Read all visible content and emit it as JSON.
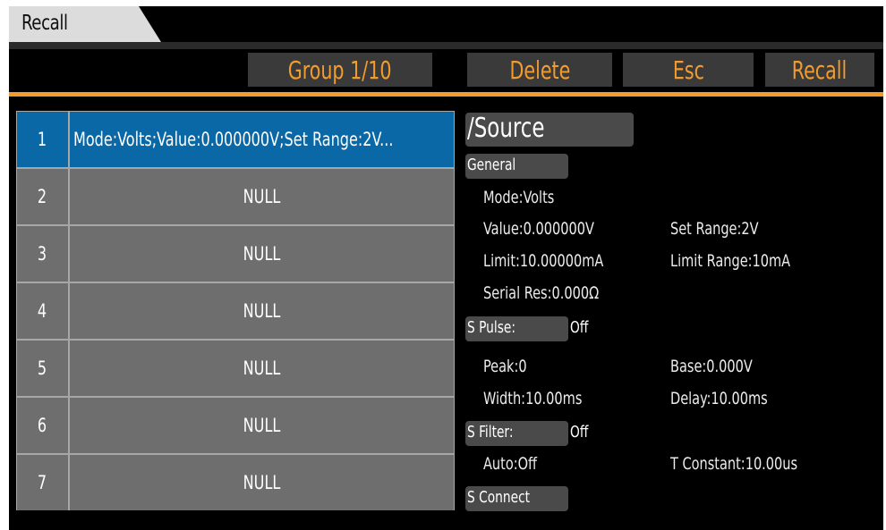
{
  "window": {
    "title": "Recall"
  },
  "toolbar": {
    "group_label": "Group 1/10",
    "delete_label": "Delete",
    "esc_label": "Esc",
    "recall_label": "Recall"
  },
  "colors": {
    "accent": "#f29c2e",
    "selected_row": "#0a68a6",
    "row_bg": "#6e6e6e"
  },
  "table": {
    "rows": [
      {
        "index": "1",
        "value": "Mode:Volts;Value:0.000000V;Set Range:2V...",
        "selected": true
      },
      {
        "index": "2",
        "value": "NULL"
      },
      {
        "index": "3",
        "value": "NULL"
      },
      {
        "index": "4",
        "value": "NULL"
      },
      {
        "index": "5",
        "value": "NULL"
      },
      {
        "index": "6",
        "value": "NULL"
      },
      {
        "index": "7",
        "value": "NULL"
      }
    ]
  },
  "details": {
    "heading": "/Source",
    "general": {
      "label": "General",
      "mode": "Mode:Volts",
      "value": "Value:0.000000V",
      "set_range": "Set Range:2V",
      "limit": "Limit:10.00000mA",
      "limit_range": "Limit Range:10mA",
      "serial_res": "Serial Res:0.000Ω"
    },
    "pulse": {
      "label": "S Pulse:",
      "state": "Off",
      "peak": "Peak:0",
      "base": "Base:0.000V",
      "width": "Width:10.00ms",
      "delay": "Delay:10.00ms"
    },
    "filter": {
      "label": "S Filter:",
      "state": "Off",
      "auto": "Auto:Off",
      "t_constant": "T Constant:10.00us"
    },
    "connect": {
      "label": "S Connect"
    }
  }
}
